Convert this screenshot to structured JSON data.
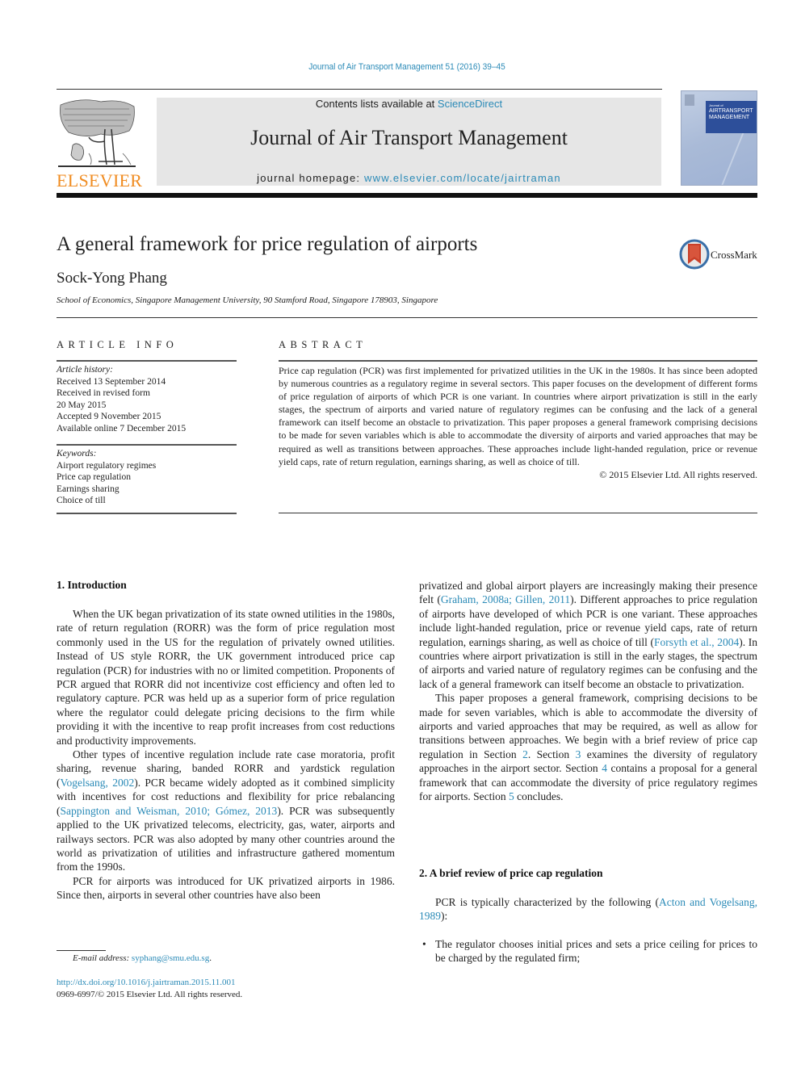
{
  "header": {
    "running_head": "Journal of Air Transport Management 51 (2016) 39–45",
    "contents_prefix": "Contents lists available at ",
    "contents_link": "ScienceDirect",
    "journal_title": "Journal of Air Transport Management",
    "homepage_prefix": "journal homepage: ",
    "homepage_link": "www.elsevier.com/locate/jairtraman",
    "publisher_logo_text": "ELSEVIER",
    "cover": {
      "small_text": "Journal of",
      "line1": "AIRTRANSPORT",
      "line2": "MANAGEMENT"
    },
    "colors": {
      "link": "#2a8ab7",
      "elsevier_orange": "#f08c21",
      "masthead_bg": "#e6e6e6",
      "cover_band": "#2d4f9a"
    }
  },
  "article": {
    "title": "A general framework for price regulation of airports",
    "author": "Sock-Yong Phang",
    "affiliation": "School of Economics, Singapore Management University, 90 Stamford Road, Singapore 178903, Singapore",
    "crossmark_label": "CrossMark"
  },
  "article_info": {
    "heading": "ARTICLE INFO",
    "history_label": "Article history:",
    "history": [
      "Received 13 September 2014",
      "Received in revised form",
      "20 May 2015",
      "Accepted 9 November 2015",
      "Available online 7 December 2015"
    ],
    "keywords_label": "Keywords:",
    "keywords": [
      "Airport regulatory regimes",
      "Price cap regulation",
      "Earnings sharing",
      "Choice of till"
    ]
  },
  "abstract": {
    "heading": "ABSTRACT",
    "text": "Price cap regulation (PCR) was first implemented for privatized utilities in the UK in the 1980s. It has since been adopted by numerous countries as a regulatory regime in several sectors. This paper focuses on the development of different forms of price regulation of airports of which PCR is one variant. In countries where airport privatization is still in the early stages, the spectrum of airports and varied nature of regulatory regimes can be confusing and the lack of a general framework can itself become an obstacle to privatization. This paper proposes a general framework comprising decisions to be made for seven variables which is able to accommodate the diversity of airports and varied approaches that may be required as well as transitions between approaches. These approaches include light-handed regulation, price or revenue yield caps, rate of return regulation, earnings sharing, as well as choice of till.",
    "copyright": "© 2015 Elsevier Ltd. All rights reserved."
  },
  "body": {
    "section1": {
      "heading": "1.  Introduction",
      "p1": "When the UK began privatization of its state owned utilities in the 1980s, rate of return regulation (RORR) was the form of price regulation most commonly used in the US for the regulation of privately owned utilities. Instead of US style RORR, the UK government introduced price cap regulation (PCR) for industries with no or limited competition. Proponents of PCR argued that RORR did not incentivize cost efficiency and often led to regulatory capture. PCR was held up as a superior form of price regulation where the regulator could delegate pricing decisions to the firm while providing it with the incentive to reap profit increases from cost reductions and productivity improvements.",
      "p2_a": "Other types of incentive regulation include rate case moratoria, profit sharing, revenue sharing, banded RORR and yardstick regulation (",
      "p2_ref1": "Vogelsang, 2002",
      "p2_b": "). PCR became widely adopted as it combined simplicity with incentives for cost reductions and flexibility for price rebalancing (",
      "p2_ref2": "Sappington and Weisman, 2010; Gómez, 2013",
      "p2_c": "). PCR was subsequently applied to the UK privatized telecoms, electricity, gas, water, airports and railways sectors. PCR was also adopted by many other countries around the world as privatization of utilities and infrastructure gathered momentum from the 1990s.",
      "p3": "PCR for airports was introduced for UK privatized airports in 1986. Since then, airports in several other countries have also been",
      "p3_cont_a": "privatized and global airport players are increasingly making their presence felt (",
      "p3_ref1": "Graham, 2008a; Gillen, 2011",
      "p3_cont_b": "). Different approaches to price regulation of airports have developed of which PCR is one variant. These approaches include light-handed regulation, price or revenue yield caps, rate of return regulation, earnings sharing, as well as choice of till (",
      "p3_ref2": "Forsyth et al., 2004",
      "p3_cont_c": "). In countries where airport privatization is still in the early stages, the spectrum of airports and varied nature of regulatory regimes can be confusing and the lack of a general framework can itself become an obstacle to privatization.",
      "p4_a": "This paper proposes a general framework, comprising decisions to be made for seven variables, which is able to accommodate the diversity of airports and varied approaches that may be required, as well as allow for transitions between approaches. We begin with a brief review of price cap regulation in Section ",
      "p4_s2": "2",
      "p4_b": ". Section ",
      "p4_s3": "3",
      "p4_c": " examines the diversity of regulatory approaches in the airport sector. Section ",
      "p4_s4": "4",
      "p4_d": " contains a proposal for a general framework that can accommodate the diversity of price regulatory regimes for airports. Section ",
      "p4_s5": "5",
      "p4_e": " concludes."
    },
    "section2": {
      "heading": "2.  A brief review of price cap regulation",
      "p1_a": "PCR is typically characterized by the following (",
      "p1_ref": "Acton and Vogelsang, 1989",
      "p1_b": "):",
      "bullets": [
        "The regulator chooses initial prices and sets a price ceiling for prices to be charged by the regulated firm;"
      ],
      "bullet_glyph": "•"
    }
  },
  "footer": {
    "email_label": "E-mail address: ",
    "email": "syphang@smu.edu.sg",
    "email_suffix": ".",
    "doi": "http://dx.doi.org/10.1016/j.jairtraman.2015.11.001",
    "issn_line": "0969-6997/© 2015 Elsevier Ltd. All rights reserved."
  }
}
